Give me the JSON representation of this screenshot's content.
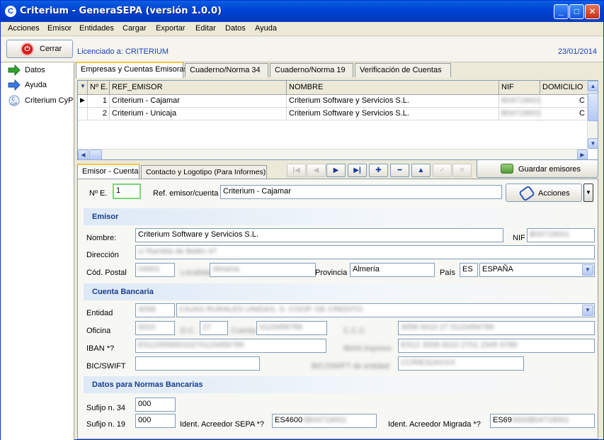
{
  "window": {
    "title": "Criterium - GeneraSEPA (versión 1.0.0)"
  },
  "menu": [
    "Acciones",
    "Emisor",
    "Entidades",
    "Cargar",
    "Exportar",
    "Editar",
    "Datos",
    "Ayuda"
  ],
  "toolbar": {
    "close_label": "Cerrar",
    "license": "Licenciado a: CRITERIUM",
    "date": "23/01/2014"
  },
  "sidebar": {
    "items": [
      {
        "label": "Datos",
        "icon": "green-arrow-icon"
      },
      {
        "label": "Ayuda",
        "icon": "blue-arrow-icon"
      },
      {
        "label": "Criterium CyP",
        "icon": "cyp-logo-icon"
      }
    ]
  },
  "tabs": [
    {
      "label": "Empresas y Cuentas Emisoras",
      "active": true
    },
    {
      "label": "Cuaderno/Norma 34",
      "active": false
    },
    {
      "label": "Cuaderno/Norma 19",
      "active": false
    },
    {
      "label": "Verificación de Cuentas",
      "active": false
    }
  ],
  "grid": {
    "columns": [
      "Nº E.",
      "REF_EMISOR",
      "NOMBRE",
      "NIF",
      "DOMICILIO"
    ],
    "rows": [
      {
        "num": "1",
        "ref": "Criterium - Cajamar",
        "nombre": "Criterium Software y Servicios S.L.",
        "nif": "B04719001",
        "domicilio": "C"
      },
      {
        "num": "2",
        "ref": "Criterium - Unicaja",
        "nombre": "Criterium Software y Servicios S.L.",
        "nif": "B04719001",
        "domicilio": "C"
      }
    ]
  },
  "subtabs": [
    {
      "label": "Emisor - Cuenta",
      "active": true
    },
    {
      "label": "Contacto y Logotipo (Para Informes)",
      "active": false
    }
  ],
  "nav_buttons": [
    "first",
    "prior",
    "next",
    "last",
    "insert",
    "delete",
    "edit",
    "post",
    "cancel"
  ],
  "save_label": "Guardar emisores",
  "form": {
    "num_label": "Nº E.",
    "num_value": "1",
    "ref_label": "Ref. emisor/cuenta",
    "ref_value": "Criterium - Cajamar",
    "acciones_label": "Acciones",
    "emisor_section": "Emisor",
    "nombre_label": "Nombre:",
    "nombre_value": "Criterium Software y Servicios S.L.",
    "nif_label": "NIF",
    "nif_value": "B04719001",
    "direccion_label": "Dirección",
    "direccion_value": "c/ Rambla de Belén 47",
    "cp_label": "Cód. Postal",
    "cp_value": "04001",
    "localidad_label": "Localidad",
    "localidad_value": "Almería",
    "provincia_label": "Provincia",
    "provincia_value": "Almería",
    "pais_label": "País",
    "pais_code": "ES",
    "pais_value": "ESPAÑA",
    "cuenta_section": "Cuenta Bancaria",
    "entidad_label": "Entidad",
    "entidad_code": "3058",
    "entidad_value": "CAJAS RURALES UNIDAS, S. COOP. DE CREDITO",
    "oficina_label": "Oficina",
    "oficina_value": "0010",
    "dc_label": "D.C.",
    "dc_value": "27",
    "cuenta_label": "Cuenta",
    "cuenta_value": "0123456789",
    "ccc_label": "C.C.C.",
    "ccc_value": "3058 0010 27 0123456789",
    "iban_label": "IBAN *?",
    "iban_value": "ES1230580010270123456789",
    "iban_fmt_label": "IBAN impreso",
    "iban_fmt_value": "ES12 3058 0010 2701 2345 6789",
    "bic_label": "BIC/SWIFT",
    "bic_value": "",
    "bic_ent_label": "BIC/SWIFT de entidad",
    "bic_ent_value": "CCRIES2AXXX",
    "normas_section": "Datos para Normas Bancarias",
    "sufijo34_label": "Sufijo n. 34",
    "sufijo34_value": "000",
    "sufijo19_label": "Sufijo n. 19",
    "sufijo19_value": "000",
    "acreedor_label": "Ident. Acreedor SEPA *?",
    "acreedor_prefix": "ES4600",
    "acreedor_rest": "0B04719001",
    "migrada_label": "Ident. Acreedor Migrada *?",
    "migrada_prefix": "ES69",
    "migrada_rest": "0000B04719001"
  }
}
